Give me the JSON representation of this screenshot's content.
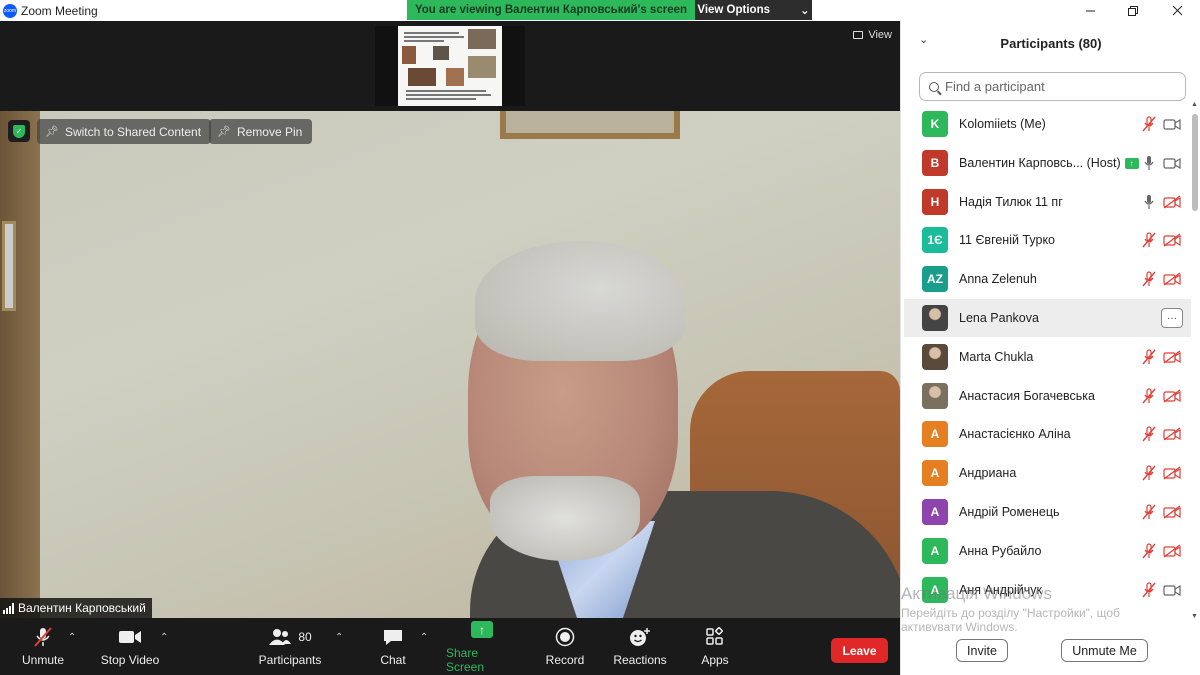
{
  "window": {
    "title": "Zoom Meeting",
    "logo_text": "zoom"
  },
  "share_banner": {
    "text": "You are viewing Валентин Карповський's screen",
    "view_options": "View Options"
  },
  "view_button": "View",
  "video": {
    "switch_label": "Switch to Shared Content",
    "remove_pin_label": "Remove Pin",
    "speaker_name": "Валентин Карповський"
  },
  "toolbar": {
    "unmute": "Unmute",
    "stop_video": "Stop Video",
    "participants": "Participants",
    "participants_count": "80",
    "chat": "Chat",
    "share_screen": "Share Screen",
    "record": "Record",
    "reactions": "Reactions",
    "apps": "Apps",
    "leave": "Leave"
  },
  "panel": {
    "title": "Participants (80)",
    "search_placeholder": "Find a participant",
    "invite": "Invite",
    "unmute_me": "Unmute Me"
  },
  "participants": [
    {
      "initials": "K",
      "name": "Kolomiiets (Me)",
      "color": "#2db85c",
      "mic": "muted",
      "cam": "on"
    },
    {
      "initials": "В",
      "name": "Валентин Карповсь... (Host)",
      "color": "#c0392b",
      "mic": "on",
      "cam": "on",
      "sharing": true
    },
    {
      "initials": "Н",
      "name": "Надія Тилюк 11 пг",
      "color": "#c0392b",
      "mic": "on",
      "cam": "off"
    },
    {
      "initials": "1Є",
      "name": "11 Євгеній Турко",
      "color": "#1abc9c",
      "mic": "muted",
      "cam": "off"
    },
    {
      "initials": "AZ",
      "name": "Anna Zelenuh",
      "color": "#1a9e8c",
      "mic": "muted",
      "cam": "off"
    },
    {
      "initials": "",
      "name": "Lena Pankova",
      "color": "#444444",
      "photo": true,
      "highlighted": true
    },
    {
      "initials": "",
      "name": "Marta Chukla",
      "color": "#5a4a3a",
      "photo": true,
      "mic": "muted",
      "cam": "off"
    },
    {
      "initials": "",
      "name": "Анастасия Богачевська",
      "color": "#7a7060",
      "photo": true,
      "mic": "muted",
      "cam": "off"
    },
    {
      "initials": "А",
      "name": "Анастасієнко Аліна",
      "color": "#e67e22",
      "mic": "muted",
      "cam": "off"
    },
    {
      "initials": "А",
      "name": "Андриана",
      "color": "#e67e22",
      "mic": "muted",
      "cam": "off"
    },
    {
      "initials": "А",
      "name": "Андрій Роменець",
      "color": "#8e44ad",
      "mic": "muted",
      "cam": "off"
    },
    {
      "initials": "А",
      "name": "Анна Рубайло",
      "color": "#2db85c",
      "mic": "muted",
      "cam": "off"
    },
    {
      "initials": "А",
      "name": "Аня Андрійчук",
      "color": "#2db85c",
      "mic": "muted",
      "cam": "on"
    }
  ],
  "watermark": {
    "line1": "Активація Windows",
    "line2": "Перейдіть до розділу \"Настройки\", щоб",
    "line3": "активувати Windows."
  },
  "colors": {
    "accent_green": "#2db85c",
    "leave_red": "#e02828",
    "muted_red": "#e0403a"
  }
}
